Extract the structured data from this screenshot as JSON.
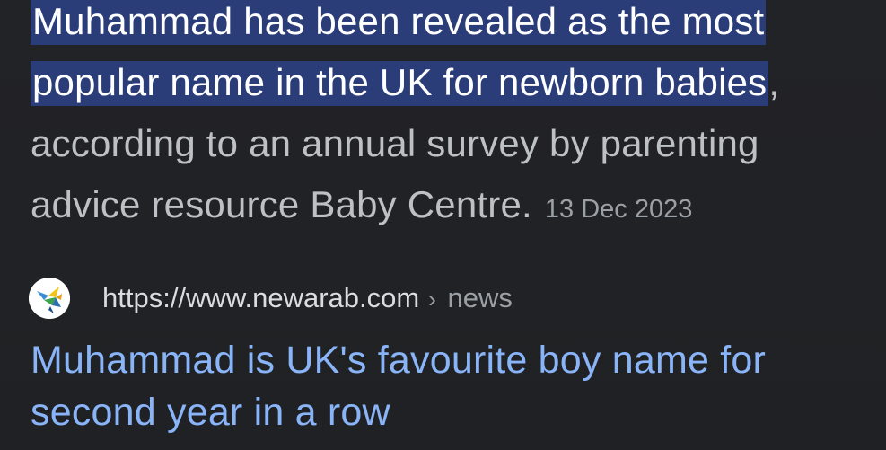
{
  "snippet": {
    "highlighted_line_1": "Muhammad has been revealed as the most",
    "highlighted_line_2": "popular name in the UK for newborn babies",
    "trailing_punct": ",",
    "rest_text": "according to an annual survey by parenting advice resource Baby Centre.",
    "date": "13 Dec 2023",
    "highlight_color": "#2b3d78",
    "text_color": "#bdc1c6"
  },
  "source": {
    "favicon": "newarab-bird-icon",
    "url": "https://www.newarab.com",
    "breadcrumb_separator": "›",
    "breadcrumb": "news"
  },
  "result": {
    "title": "Muhammad is UK's favourite boy name for second year in a row",
    "link_color": "#8ab4f8"
  }
}
